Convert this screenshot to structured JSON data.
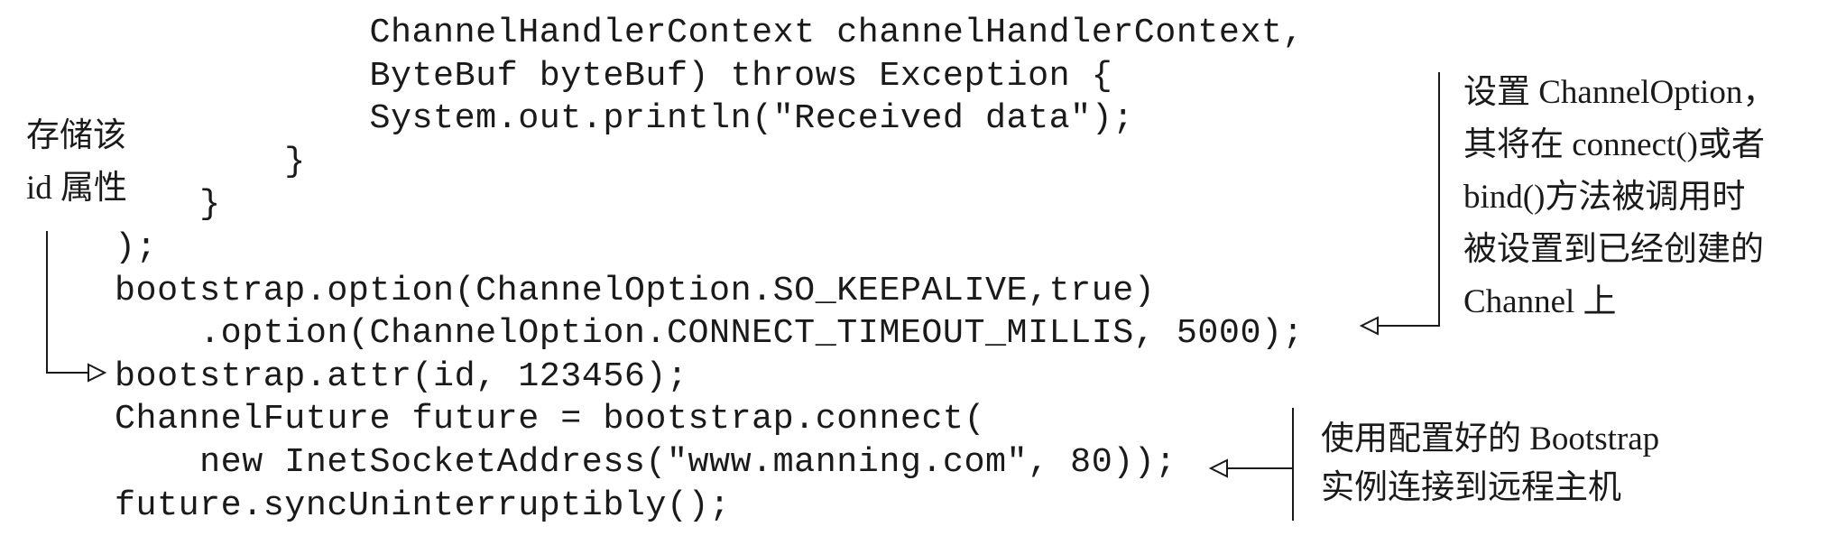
{
  "code_lines": [
    "            ChannelHandlerContext channelHandlerContext,",
    "            ByteBuf byteBuf) throws Exception {",
    "            System.out.println(\"Received data\");",
    "        }",
    "    }",
    ");",
    "bootstrap.option(ChannelOption.SO_KEEPALIVE,true)",
    "    .option(ChannelOption.CONNECT_TIMEOUT_MILLIS, 5000);",
    "bootstrap.attr(id, 123456);",
    "ChannelFuture future = bootstrap.connect(",
    "    new InetSocketAddress(\"www.manning.com\", 80));",
    "future.syncUninterruptibly();"
  ],
  "annotations": {
    "store_id": [
      "存储该",
      "id 属性"
    ],
    "set_option": [
      "设置 ChannelOption，",
      "其将在 connect()或者",
      "bind()方法被调用时",
      "被设置到已经创建的",
      "Channel 上"
    ],
    "connect": [
      "使用配置好的 Bootstrap",
      "实例连接到远程主机"
    ]
  }
}
